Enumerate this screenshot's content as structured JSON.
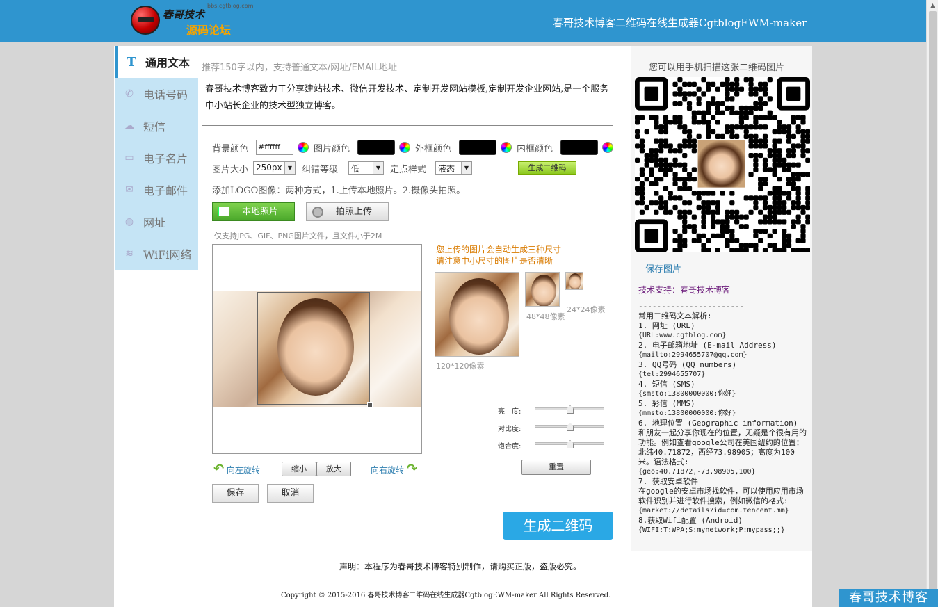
{
  "header": {
    "logo_text_1": "春哥技术",
    "logo_text_2": "源码论坛",
    "logo_url": "bbs.cgtblog.com",
    "title": "春哥技术博客二维码在线生成器CgtblogEWM-maker"
  },
  "sidebar": {
    "items": [
      {
        "icon": "T",
        "label": "通用文本"
      },
      {
        "icon": "phone-icon",
        "label": "电话号码"
      },
      {
        "icon": "chat-icon",
        "label": "短信"
      },
      {
        "icon": "card-icon",
        "label": "电子名片"
      },
      {
        "icon": "mail-icon",
        "label": "电子邮件"
      },
      {
        "icon": "globe-icon",
        "label": "网址"
      },
      {
        "icon": "wifi-icon",
        "label": "WiFi网络"
      }
    ]
  },
  "form": {
    "hint": "推荐150字以内，支持普通文本/网址/EMAIL地址",
    "text": "春哥技术博客致力于分享建站技术、微信开发技术、定制开发网站模板,定制开发企业网站,是一个服务中小站长企业的技术型独立博客。",
    "bg_color_label": "背景颜色",
    "bg_color_value": "#ffffff",
    "img_color_label": "图片颜色",
    "outer_color_label": "外框颜色",
    "inner_color_label": "内框颜色",
    "size_label": "图片大小",
    "size_value": "250px",
    "ecc_label": "纠错等级",
    "ecc_value": "低",
    "dot_label": "定点样式",
    "dot_value": "液态",
    "generate_small": "生成二维码",
    "logo_hint": "添加LOGO图像：两种方式，1.上传本地照片。2.摄像头拍照。",
    "local_photo": "本地照片",
    "camera_upload": "拍照上传",
    "file_note": "仅支持JPG、GIF、PNG图片文件，且文件小于2M",
    "rotate_left": "向左旋转",
    "rotate_right": "向右旋转",
    "zoom_out": "缩小",
    "zoom_in": "放大",
    "save": "保存",
    "cancel": "取消",
    "preview_note_1": "您上传的图片会自动生成三种尺寸",
    "preview_note_2": "请注意中小尺寸的图片是否清晰",
    "size_120": "120*120像素",
    "size_48": "48*48像素",
    "size_24": "24*24像素",
    "brightness": "亮　度:",
    "contrast": "对比度:",
    "saturation": "饱合度:",
    "reset": "重置",
    "generate_big": "生成二维码"
  },
  "right": {
    "scan_title": "您可以用手机扫描这张二维码图片",
    "save_image": "保存图片",
    "support": "技术支持：春哥技术博客",
    "divider": "-----------------------",
    "guide_title": "常用二维码文本解析:",
    "guide": [
      {
        "t": "1. 网址 (URL)",
        "m": "{URL:www.cgtblog.com}"
      },
      {
        "t": "2. 电子邮箱地址 (E-mail Address)",
        "m": "{mailto:2994655707@qq.com}"
      },
      {
        "t": "3. QQ号码 (QQ numbers)",
        "m": "{tel:2994655707}"
      },
      {
        "t": "4. 短信 (SMS)",
        "m": "{smsto:13800000000:你好}"
      },
      {
        "t": "5. 彩信 (MMS)",
        "m": "{mmsto:13800000000:你好}"
      },
      {
        "t": "6. 地理位置 (Geographic information)",
        "d": "和朋友一起分享你现在的位置，无疑是个很有用的功能。例如查看google公司在美国纽约的位置：北纬40.71872，西经73.98905；高度为100米。语法格式:",
        "m": "{geo:40.71872,-73.98905,100}"
      },
      {
        "t": "7. 获取安卓软件",
        "d": "在google的安卓市场找软件，可以使用应用市场软件识别并进行软件搜索，例如微信的格式:",
        "m": "{market://details?id=com.tencent.mm}"
      },
      {
        "t": "8.获取Wifi配置 (Android)",
        "m": "{WIFI:T:WPA;S:mynetwork;P:mypass;;}"
      }
    ]
  },
  "footer": {
    "declaration": "声明：本程序为春哥技术博客特别制作，请购买正版，盗版必究。",
    "copyright": "Copyright © 2015-2016 春哥技术博客二维码在线生成器CgtblogEWM-maker All Rights Reserved.",
    "watermark": "春哥技术博客"
  }
}
